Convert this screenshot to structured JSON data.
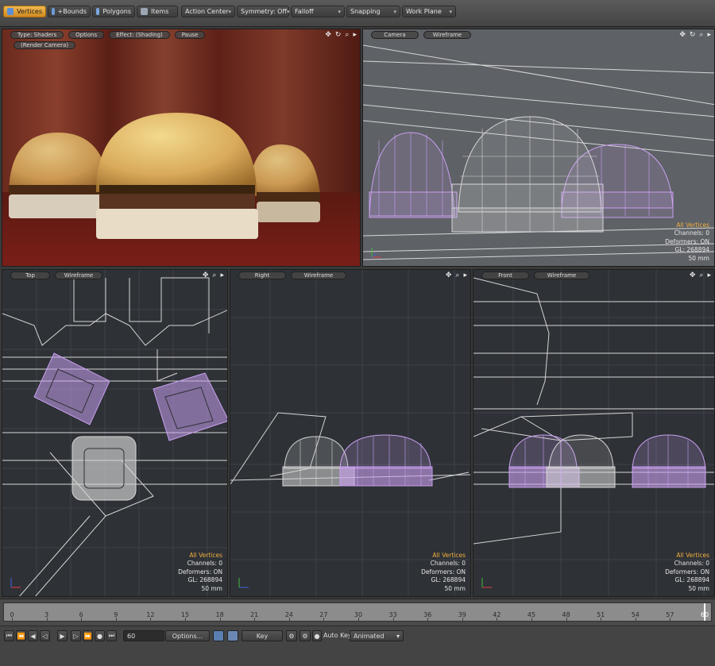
{
  "toolbar": {
    "vertices": "Vertices",
    "bounds": "+Bounds",
    "polygons": "Polygons",
    "items": "Items",
    "action_center": "Action Center",
    "symmetry": "Symmetry: Off",
    "falloff": "Falloff",
    "snapping": "Snapping",
    "work_plane": "Work Plane"
  },
  "render_view": {
    "type": "Type: Shaders",
    "options": "Options",
    "effect": "Effect: (Shading)",
    "pause": "Pause",
    "camera": "(Render Camera)"
  },
  "camera_view": {
    "view": "Camera",
    "mode": "Wireframe"
  },
  "top_view": {
    "view": "Top",
    "mode": "Wireframe"
  },
  "right_view": {
    "view": "Right",
    "mode": "Wireframe"
  },
  "front_view": {
    "view": "Front",
    "mode": "Wireframe"
  },
  "hud": {
    "selection": "All Vertices",
    "channels": "Channels: 0",
    "deformers": "Deformers: ON",
    "gl": "GL: 268894",
    "scale": "50 mm"
  },
  "timeline": {
    "ticks": [
      "0",
      "3",
      "6",
      "9",
      "12",
      "15",
      "18",
      "21",
      "24",
      "27",
      "30",
      "33",
      "36",
      "39",
      "42",
      "45",
      "48",
      "51",
      "54",
      "57",
      "60"
    ],
    "current_frame": "60"
  },
  "playback": {
    "frame_value": "60",
    "options_label": "Options...",
    "key_label": "Key",
    "auto_key_label": "Auto Key",
    "animated_label": "Animated"
  },
  "colors": {
    "accent": "#e8a83a",
    "selection_wire": "#c9a0f0",
    "wire": "#d8d8d8"
  }
}
